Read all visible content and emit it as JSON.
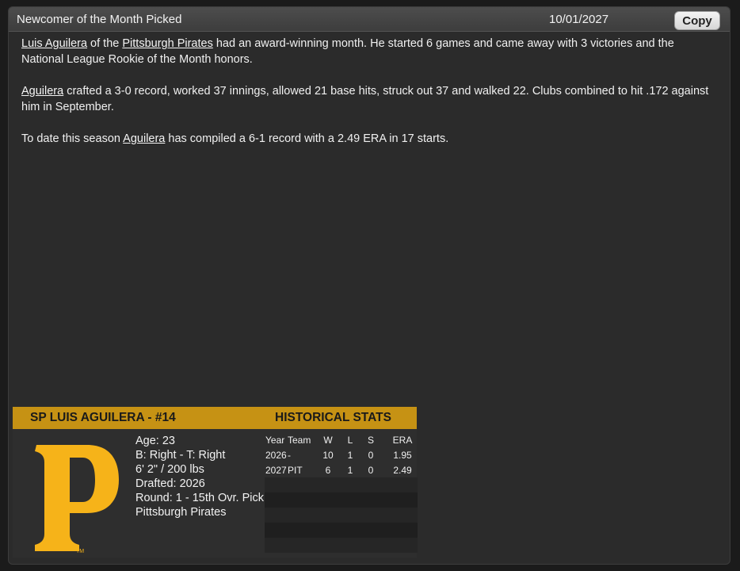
{
  "window": {
    "title": "Newcomer of the Month Picked",
    "date": "10/01/2027",
    "copy_label": "Copy"
  },
  "article": {
    "p1": {
      "player": "Luis Aguilera",
      "t1": " of the ",
      "team": "Pittsburgh Pirates",
      "t2": " had an award-winning month. He started 6 games and came away with 3 victories and the National League Rookie of the Month honors."
    },
    "p2": {
      "player": "Aguilera",
      "t1": " crafted a 3-0 record, worked 37 innings, allowed 21 base hits, struck out 37 and walked 22. Clubs combined to hit .172 against him in September."
    },
    "p3": {
      "t0": "To date this season ",
      "player": "Aguilera",
      "t1": " has compiled a 6-1 record with a 2.49 ERA in 17 starts."
    }
  },
  "card": {
    "name": "SP LUIS AGUILERA - #14",
    "hist_title": "HISTORICAL STATS",
    "logo_icon": "pirates-p-logo",
    "logo_tm": "TM",
    "colors": {
      "gold": "#c69214",
      "logo_gold": "#f6b319"
    },
    "info": [
      "Age: 23",
      "B: Right - T: Right",
      "6' 2\" / 200 lbs",
      "Drafted: 2026",
      "Round: 1 - 15th Ovr. Pick",
      "Pittsburgh Pirates"
    ],
    "stats": {
      "headers": [
        "Year",
        "Team",
        "W",
        "L",
        "S",
        "ERA"
      ],
      "rows": [
        [
          "2026",
          "-",
          "10",
          "1",
          "0",
          "1.95"
        ],
        [
          "2027",
          "PIT",
          "6",
          "1",
          "0",
          "2.49"
        ]
      ]
    }
  }
}
